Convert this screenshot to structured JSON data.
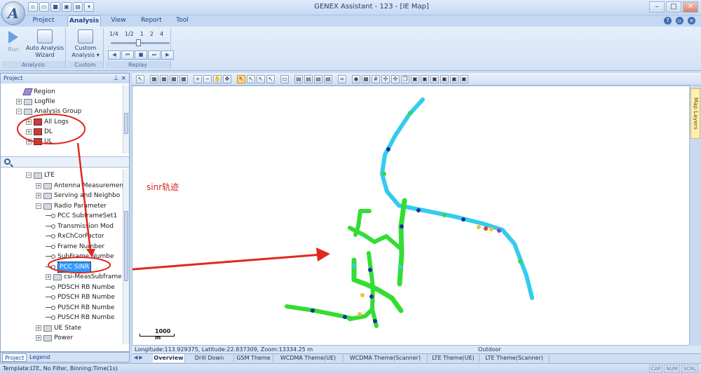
{
  "window": {
    "title": "GENEX Assistant - 123 - [IE Map]"
  },
  "ribbon_tabs": [
    "Project",
    "Analysis",
    "View",
    "Report",
    "Tool"
  ],
  "ribbon": {
    "analysis_group": {
      "run": "Run",
      "wizard_line1": "Auto Analysis",
      "wizard_line2": "Wizard",
      "label": "Analysis"
    },
    "custom_group": {
      "custom_line1": "Custom",
      "custom_line2": "Analysis ▾",
      "label": "Custom"
    },
    "replay_group": {
      "speeds": [
        "1/4",
        "1/2",
        "1",
        "2",
        "4"
      ],
      "label": "Replay"
    }
  },
  "project_panel": {
    "title": "Project",
    "top_tree": [
      "Region",
      "Logfile",
      "Analysis Group",
      "All Logs",
      "DL",
      "UL"
    ],
    "bottom_tree": [
      "LTE",
      "Antenna Measuremen",
      "Serving and Neighbo",
      "Radio Parameter",
      "PCC SubframeSet1",
      "Transmission Mod",
      "RxChCorFactor",
      "Frame Number",
      "SubFrame Numbe",
      "PCC SINR",
      "csi-MeasSubframe",
      "PDSCH RB Numbe",
      "PDSCH RB Numbe",
      "PUSCH RB Numbe",
      "PUSCH RB Numbe",
      "UE State",
      "Power"
    ],
    "tabs": [
      "Project",
      "Legend"
    ]
  },
  "map": {
    "annotation": "sinr轨迹",
    "scale": "1000 m",
    "layers_tab": "Map Layers",
    "coords": "Longitude:113.929375, Latitude:22.837309, Zoom:13334.25 m",
    "outdoor": "Outdoor",
    "route_colors": {
      "good": "#33dd33",
      "mid": "#33ccee",
      "low": "#1a2fa0",
      "warn": "#f2c22a",
      "bad": "#e23a2a"
    }
  },
  "theme_tabs": [
    "Overview",
    "Drill Down",
    "GSM Theme",
    "WCDMA Theme(UE)",
    "WCDMA Theme(Scanner)",
    "LTE Theme(UE)",
    "LTE Theme(Scanner)"
  ],
  "status": {
    "left": "Template:LTE,  No Filter,  Binning:Time(1s)",
    "indicators": [
      "CAP",
      "NUM",
      "SCRL"
    ]
  }
}
